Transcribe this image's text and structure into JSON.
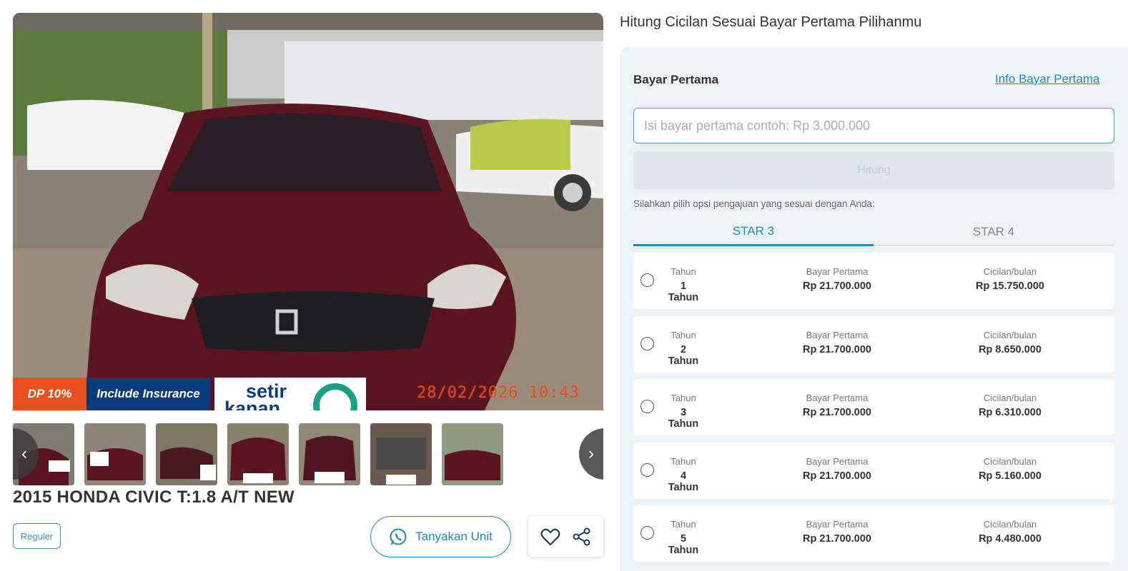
{
  "listing": {
    "title": "2015 HONDA CIVIC T:1.8 A/T NEW",
    "tag": "Reguler",
    "ask_button": "Tanyakan Unit",
    "hero": {
      "dp_badge": "DP 10%",
      "insurance_badge": "Include Insurance",
      "logo_text": "setir",
      "logo_text_2": "kanan",
      "timestamp": "28/02/2026 10:43"
    },
    "thumbnails": [
      "photo-1",
      "photo-2",
      "photo-3",
      "photo-4",
      "photo-5",
      "photo-6",
      "photo-7"
    ]
  },
  "calculator": {
    "title": "Hitung Cicilan Sesuai Bayar Pertama Pilihanmu",
    "bayar_label": "Bayar Pertama",
    "info_link": "Info Bayar Pertama",
    "input_placeholder": "Isi bayar pertama contoh: Rp 3.000.000",
    "hitung_button": "Hitung",
    "hint": "Silahkan pilih opsi pengajuan yang sesuai dengan Anda:",
    "tabs": [
      "STAR 3",
      "STAR 4"
    ],
    "active_tab": "STAR 3",
    "col_labels": {
      "tenor": "Tahun",
      "bayar": "Bayar Pertama",
      "cicilan": "Cicilan/bulan"
    },
    "options": [
      {
        "tenor": "1 Tahun",
        "bayar": "Rp 21.700.000",
        "cicilan": "Rp 15.750.000"
      },
      {
        "tenor": "2 Tahun",
        "bayar": "Rp 21.700.000",
        "cicilan": "Rp 8.650.000"
      },
      {
        "tenor": "3 Tahun",
        "bayar": "Rp 21.700.000",
        "cicilan": "Rp 6.310.000"
      },
      {
        "tenor": "4 Tahun",
        "bayar": "Rp 21.700.000",
        "cicilan": "Rp 5.160.000"
      },
      {
        "tenor": "5 Tahun",
        "bayar": "Rp 21.700.000",
        "cicilan": "Rp 4.480.000"
      }
    ]
  },
  "colors": {
    "accent": "#1a8bc0",
    "dp_badge": "#e8501e",
    "insurance_badge": "#0c3b7c",
    "car_body": "#5a1520"
  },
  "icons": [
    "chevron-left-icon",
    "chevron-right-icon",
    "whatsapp-icon",
    "heart-icon",
    "share-icon"
  ]
}
